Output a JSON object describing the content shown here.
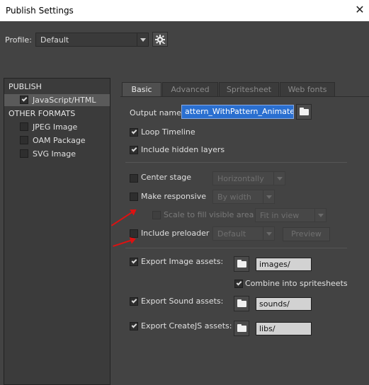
{
  "window": {
    "title": "Publish Settings",
    "close_glyph": "✕"
  },
  "profile": {
    "label": "Profile:",
    "value": "Default",
    "gear_icon": "gear-icon"
  },
  "left_panel": {
    "publish_head": "PUBLISH",
    "publish_items": [
      {
        "label": "JavaScript/HTML",
        "checked": true
      }
    ],
    "other_head": "OTHER FORMATS",
    "other_items": [
      {
        "label": "JPEG Image",
        "checked": false
      },
      {
        "label": "OAM Package",
        "checked": false
      },
      {
        "label": "SVG Image",
        "checked": false
      }
    ]
  },
  "tabs": [
    "Basic",
    "Advanced",
    "Spritesheet",
    "Web fonts"
  ],
  "basic": {
    "output_label": "Output name:",
    "output_value": "attern_WithPattern_AnimateCC",
    "loop_timeline": {
      "label": "Loop Timeline",
      "checked": true
    },
    "include_hidden": {
      "label": "Include hidden layers",
      "checked": true
    },
    "center_stage": {
      "label": "Center stage",
      "checked": false,
      "select": "Horizontally"
    },
    "make_responsive": {
      "label": "Make responsive",
      "checked": false,
      "select": "By width"
    },
    "scale_to_fill": {
      "label": "Scale to fill visible area",
      "checked": false,
      "select": "Fit in view"
    },
    "include_preloader": {
      "label": "Include preloader",
      "checked": false,
      "select": "Default",
      "preview": "Preview"
    },
    "export_image": {
      "label": "Export Image assets:",
      "checked": true,
      "path": "images/"
    },
    "combine_spritesheets": {
      "label": "Combine into spritesheets",
      "checked": true
    },
    "export_sound": {
      "label": "Export Sound assets:",
      "checked": true,
      "path": "sounds/"
    },
    "export_createjs": {
      "label": "Export CreateJS assets:",
      "checked": true,
      "path": "libs/"
    }
  },
  "colors": {
    "panel_bg": "#434343",
    "annotation_arrow": "#dd1111",
    "selection": "#2a6fd0"
  }
}
